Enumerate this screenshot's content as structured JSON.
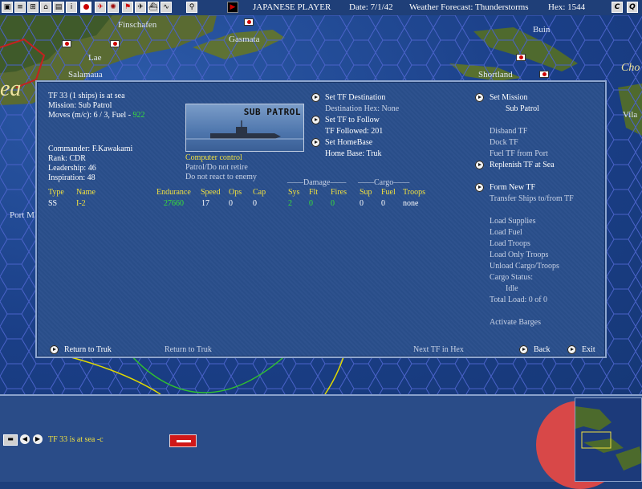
{
  "topbar": {
    "player": "JAPANESE PLAYER",
    "date": "Date: 7/1/42",
    "weather": "Weather Forecast: Thunderstorms",
    "hex": "Hex: 1544",
    "icons": [
      "unit-icon",
      "document-icon",
      "group-icon",
      "ship-icon",
      "info-icon",
      "flag-icon",
      "aircraft-icon",
      "pennant-icon",
      "plane-icon",
      "zoom-icon",
      "search-icon",
      "play-icon"
    ],
    "right_buttons": [
      "C",
      "Q"
    ]
  },
  "map": {
    "labels": [
      "Finschafen",
      "Gasmata",
      "Lae",
      "Salamaua",
      "Buin",
      "Shortland",
      "Cho",
      "Vila",
      "Port M",
      "ea"
    ]
  },
  "panel": {
    "tf_status": "TF 33 (1 ships) is at sea",
    "mission": "Mission: Sub Patrol",
    "moves": "Moves (m/c): 6 / 3, Fuel - ",
    "fuel_value": "922",
    "commander": "Commander: F.Kawakami",
    "rank": "Rank: CDR",
    "leadership": "Leadership: 46",
    "inspiration": "Inspiration: 48",
    "image_title": "SUB PATROL",
    "computer_control": "Computer control",
    "patrol_retire": "Patrol/Do not retire",
    "react": "Do not react to enemy",
    "middle": {
      "set_destination": "Set TF Destination",
      "destination_hex": "Destination Hex: None",
      "set_follow": "Set TF to Follow",
      "tf_followed": "TF Followed: 201",
      "set_homebase": "Set HomeBase",
      "home_base": "Home Base: Truk"
    },
    "right": {
      "set_mission": "Set Mission",
      "sub_patrol": "Sub Patrol",
      "disband": "Disband TF",
      "dock": "Dock TF",
      "fuel_port": "Fuel TF from Port",
      "replenish": "Replenish TF at Sea",
      "form_new": "Form New TF",
      "transfer": "Transfer Ships to/from TF",
      "load_supplies": "Load Supplies",
      "load_fuel": "Load Fuel",
      "load_troops": "Load Troops",
      "load_only_troops": "Load Only Troops",
      "unload": "Unload Cargo/Troops",
      "cargo_status": "Cargo Status:",
      "idle": "Idle",
      "total_load": "Total Load: 0 of 0",
      "activate_barges": "Activate Barges"
    },
    "group_damage": "Damage",
    "group_cargo": "Cargo",
    "columns": [
      "Type",
      "Name",
      "Endurance",
      "Speed",
      "Ops",
      "Cap",
      "Sys",
      "Flt",
      "Fires",
      "Sup",
      "Fuel",
      "Troops"
    ],
    "ship": {
      "type": "SS",
      "name": "I-2",
      "endurance": "27660",
      "speed": "17",
      "ops": "0",
      "cap": "0",
      "sys": "2",
      "flt": "0",
      "fires": "0",
      "sup": "0",
      "fuel": "0",
      "troops": "none"
    },
    "footer": {
      "return_truk_btn": "Return to Truk",
      "return_truk_text": "Return to Truk",
      "next_tf": "Next TF in Hex",
      "back": "Back",
      "exit": "Exit"
    }
  },
  "bottom": {
    "status": "TF 33 is at sea -c"
  }
}
